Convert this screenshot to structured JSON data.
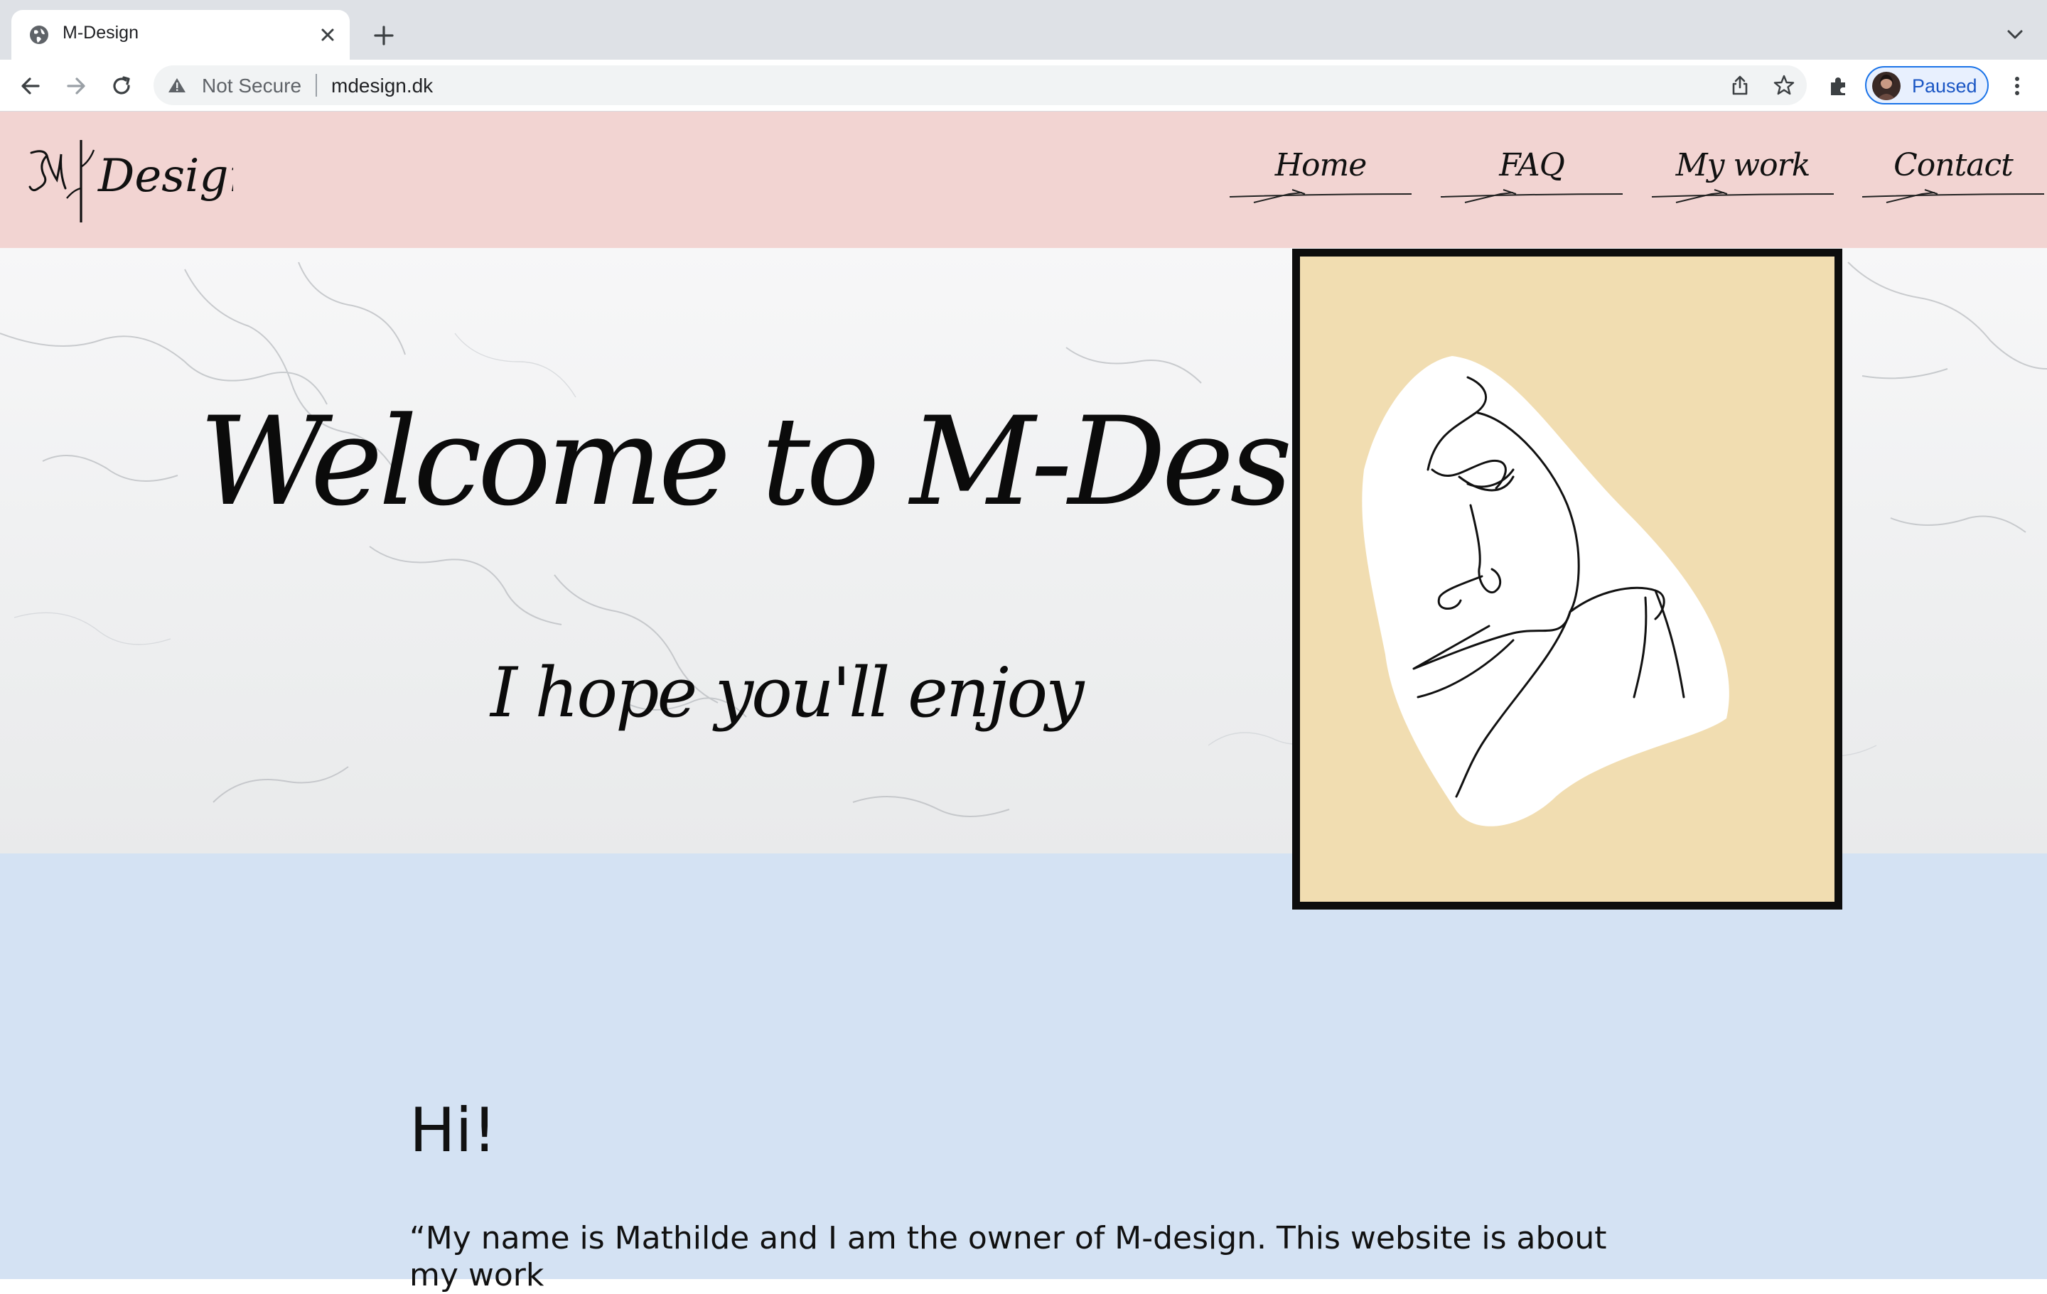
{
  "browser": {
    "tab_title": "M-Design",
    "security_label": "Not Secure",
    "url": "mdesign.dk",
    "profile_label": "Paused"
  },
  "site": {
    "logo_text": "Design",
    "nav": [
      {
        "label": "Home"
      },
      {
        "label": "FAQ"
      },
      {
        "label": "My work"
      },
      {
        "label": "Contact"
      }
    ],
    "hero": {
      "title": "Welcome to M-Design",
      "subtitle": "I hope you'll enjoy"
    },
    "content": {
      "heading": "Hi!",
      "intro": "“My name is Mathilde and I am the owner of M-design. This website is about my work"
    }
  },
  "colors": {
    "header_bg": "#f2d4d2",
    "content_bg": "#d4e2f3",
    "art_bg": "#f1ddb1",
    "profile_accent": "#1a73e8"
  }
}
